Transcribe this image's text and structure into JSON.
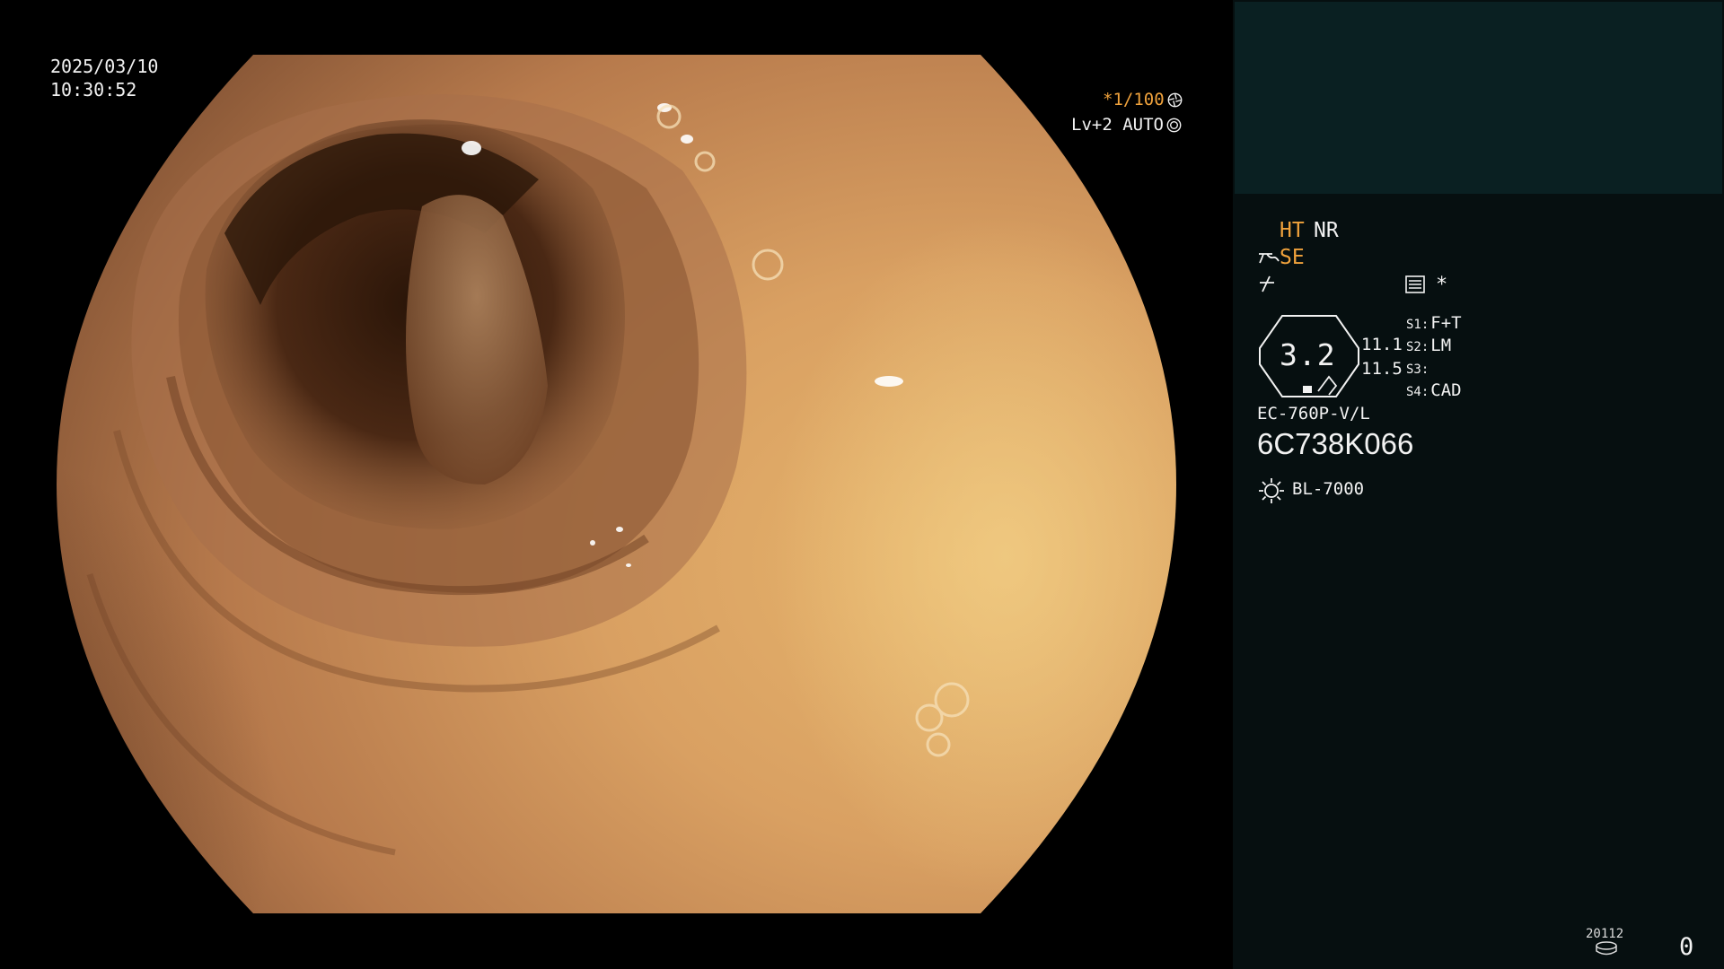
{
  "overlay": {
    "date": "2025/03/10",
    "time": "10:30:52",
    "shutter": "*1/100",
    "shutter_icon": "aperture-icon",
    "level": "Lv+2 AUTO",
    "level_icon": "iris-icon"
  },
  "panel": {
    "mode_ht": "HT",
    "mode_nr": "NR",
    "mode_se": "SE",
    "mode_se_icon": "structure-enhancement-icon",
    "freeze_icon": "freeze-slash-icon",
    "record_icon": "document-icon",
    "record_mark": "*",
    "zoom": "3.2",
    "value_1": "11.1",
    "value_2": "11.5",
    "slots": [
      {
        "key": "S1:",
        "value": "F+T"
      },
      {
        "key": "S2:",
        "value": "LM"
      },
      {
        "key": "S3:",
        "value": ""
      },
      {
        "key": "S4:",
        "value": "CAD"
      }
    ],
    "scope_model": "EC-760P-V/L",
    "scope_serial": "6C738K066",
    "light_icon": "light-source-icon",
    "light_source": "BL-7000",
    "storage_label": "20112",
    "storage_icon": "storage-disk-icon",
    "counter": "0"
  },
  "colors": {
    "accent_orange": "#f0a23c",
    "panel_bg": "#060f10",
    "thumb_bg": "#0a2022",
    "text": "#f2f2f2"
  }
}
